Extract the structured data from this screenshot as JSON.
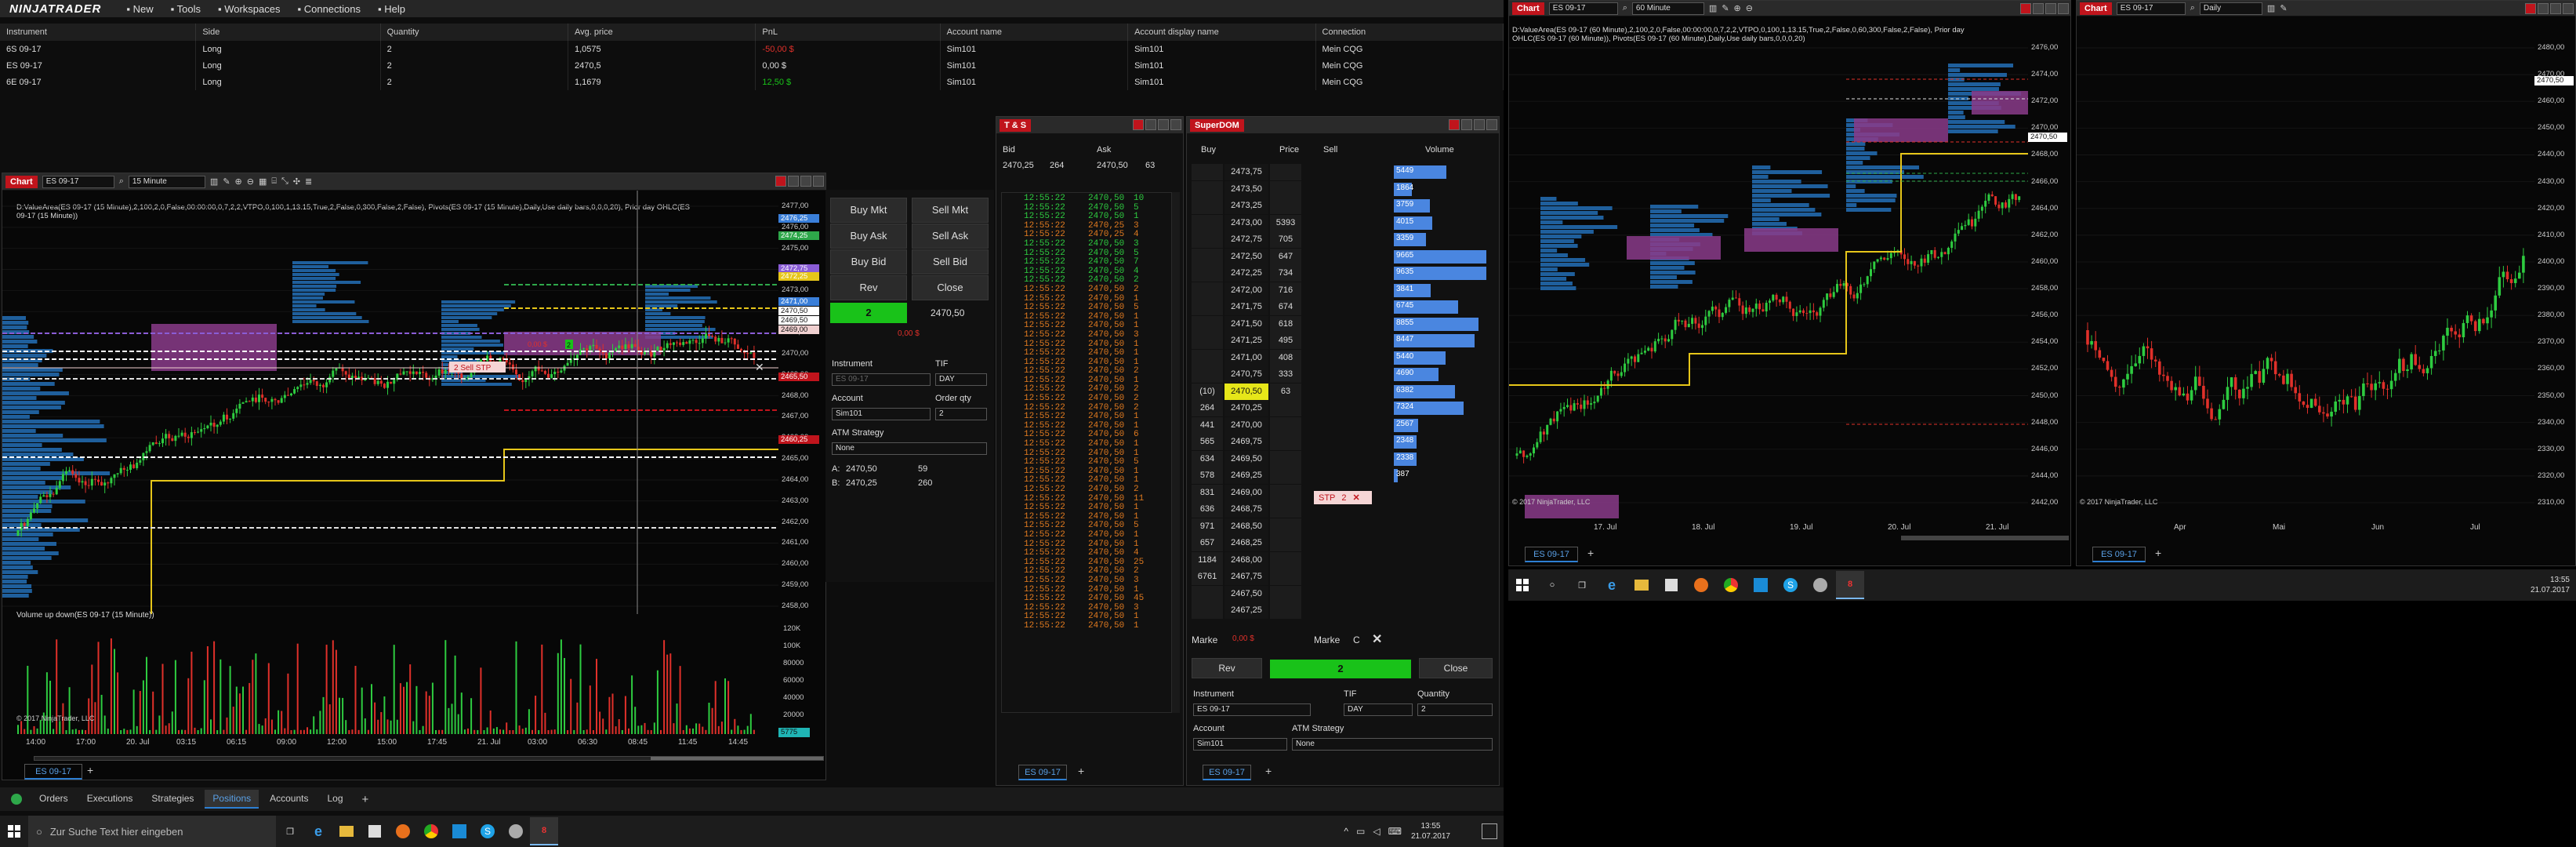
{
  "app": {
    "name": "NINJATRADER",
    "menu": [
      "New",
      "Tools",
      "Workspaces",
      "Connections",
      "Help"
    ]
  },
  "positions": {
    "columns": [
      "Instrument",
      "Side",
      "Quantity",
      "Avg. price",
      "PnL",
      "Account name",
      "Account display name",
      "Connection"
    ],
    "rows": [
      [
        "6S 09-17",
        "Long",
        "2",
        "1,0575",
        "-50,00 $",
        "Sim101",
        "Sim101",
        "Mein CQG"
      ],
      [
        "ES 09-17",
        "Long",
        "2",
        "2470,5",
        "0,00 $",
        "Sim101",
        "Sim101",
        "Mein CQG"
      ],
      [
        "6E 09-17",
        "Long",
        "2",
        "1,1679",
        "12,50 $",
        "Sim101",
        "Sim101",
        "Mein CQG"
      ]
    ],
    "pnl_colors": [
      "#e0302a",
      "#dddddd",
      "#19c219"
    ]
  },
  "chart1": {
    "tag": "Chart",
    "instrument": "ES 09-17",
    "interval": "15 Minute",
    "info1": "D:ValueArea(ES 09-17 (15 Minute),2,100,2,0,False,00:00:00,0,7,2,2,VTPO,0,100,1,13.15,True,2,False,0,300,False,2,False), Pivots(ES 09-17 (15 Minute),Daily,Use daily bars,0,0,0,20), Prior day OHLC(ES",
    "info2": "09-17 (15 Minute))",
    "price_ticks": [
      "2477,00",
      "2476,00",
      "2475,00",
      "2474,00",
      "2473,00",
      "2472,00",
      "2471,00",
      "2470,00",
      "2469,00",
      "2468,00",
      "2467,00",
      "2466,00",
      "2465,00",
      "2464,00",
      "2463,00",
      "2462,00",
      "2461,00",
      "2460,00",
      "2459,00",
      "2458,00"
    ],
    "price_tags": [
      {
        "label": "2476,25",
        "color": "#3a7fd9"
      },
      {
        "label": "2474,25",
        "color": "#2ea84a"
      },
      {
        "label": "2472,75",
        "color": "#8a5cd6"
      },
      {
        "label": "2472,25",
        "color": "#e6c619"
      },
      {
        "label": "2471,00",
        "color": "#3a7fd9"
      },
      {
        "label": "2470,50",
        "color": "#ffffff"
      },
      {
        "label": "2469,50",
        "color": "#ffffff"
      },
      {
        "label": "2469,00",
        "color": "#f0d0d0"
      },
      {
        "label": "2465,50",
        "color": "#c0141c"
      },
      {
        "label": "2460,25",
        "color": "#c0141c"
      }
    ],
    "order_label": "2  Sell STP",
    "pnl_marker": "0,00 $",
    "qty_marker": "2",
    "volume_title": "Volume up down(ES 09-17 (15 Minute))",
    "vol_ticks": [
      "120K",
      "100K",
      "80000",
      "60000",
      "40000",
      "20000"
    ],
    "vol_tag": "5775",
    "time_ticks": [
      "14:00",
      "17:00",
      "20. Jul",
      "03:15",
      "06:15",
      "09:00",
      "12:00",
      "15:00",
      "17:45",
      "21. Jul",
      "03:00",
      "06:30",
      "08:45",
      "11:45",
      "14:45"
    ],
    "copyright": "© 2017 NinjaTrader, LLC",
    "tab": "ES 09-17"
  },
  "chart_trader": {
    "buy_mkt": "Buy Mkt",
    "sell_mkt": "Sell Mkt",
    "buy_ask": "Buy Ask",
    "sell_ask": "Sell Ask",
    "buy_bid": "Buy Bid",
    "sell_bid": "Sell Bid",
    "rev": "Rev",
    "close": "Close",
    "qty": "2",
    "price": "2470,50",
    "pnl": "0,00 $",
    "instrument_label": "Instrument",
    "instrument": "ES 09-17",
    "tif_label": "TIF",
    "tif": "DAY",
    "account_label": "Account",
    "account": "Sim101",
    "orderqty_label": "Order qty",
    "orderqty": "2",
    "atm_label": "ATM Strategy",
    "atm": "None",
    "a_label": "A:",
    "a_price": "2470,50",
    "a_size": "59",
    "b_label": "B:",
    "b_price": "2470,25",
    "b_size": "260"
  },
  "ts": {
    "tag": "T & S",
    "bid_label": "Bid",
    "ask_label": "Ask",
    "bid": "2470,25",
    "bid_size": "264",
    "ask": "2470,50",
    "ask_size": "63",
    "rows": [
      [
        "12:55:22",
        "2470,50",
        "10",
        "g"
      ],
      [
        "12:55:22",
        "2470,50",
        "5",
        "g"
      ],
      [
        "12:55:22",
        "2470,50",
        "1",
        "g"
      ],
      [
        "12:55:22",
        "2470,25",
        "3",
        "o"
      ],
      [
        "12:55:22",
        "2470,25",
        "4",
        "o"
      ],
      [
        "12:55:22",
        "2470,50",
        "3",
        "g"
      ],
      [
        "12:55:22",
        "2470,50",
        "5",
        "g"
      ],
      [
        "12:55:22",
        "2470,50",
        "7",
        "g"
      ],
      [
        "12:55:22",
        "2470,50",
        "4",
        "g"
      ],
      [
        "12:55:22",
        "2470,50",
        "2",
        "g"
      ],
      [
        "12:55:22",
        "2470,50",
        "2",
        "o"
      ],
      [
        "12:55:22",
        "2470,50",
        "1",
        "o"
      ],
      [
        "12:55:22",
        "2470,50",
        "5",
        "o"
      ],
      [
        "12:55:22",
        "2470,50",
        "1",
        "o"
      ],
      [
        "12:55:22",
        "2470,50",
        "1",
        "o"
      ],
      [
        "12:55:22",
        "2470,50",
        "3",
        "o"
      ],
      [
        "12:55:22",
        "2470,50",
        "1",
        "o"
      ],
      [
        "12:55:22",
        "2470,50",
        "1",
        "o"
      ],
      [
        "12:55:22",
        "2470,50",
        "1",
        "o"
      ],
      [
        "12:55:22",
        "2470,50",
        "2",
        "o"
      ],
      [
        "12:55:22",
        "2470,50",
        "1",
        "o"
      ],
      [
        "12:55:22",
        "2470,50",
        "2",
        "o"
      ],
      [
        "12:55:22",
        "2470,50",
        "2",
        "o"
      ],
      [
        "12:55:22",
        "2470,50",
        "2",
        "o"
      ],
      [
        "12:55:22",
        "2470,50",
        "1",
        "o"
      ],
      [
        "12:55:22",
        "2470,50",
        "1",
        "o"
      ],
      [
        "12:55:22",
        "2470,50",
        "6",
        "o"
      ],
      [
        "12:55:22",
        "2470,50",
        "1",
        "o"
      ],
      [
        "12:55:22",
        "2470,50",
        "1",
        "o"
      ],
      [
        "12:55:22",
        "2470,50",
        "5",
        "o"
      ],
      [
        "12:55:22",
        "2470,50",
        "1",
        "o"
      ],
      [
        "12:55:22",
        "2470,50",
        "1",
        "o"
      ],
      [
        "12:55:22",
        "2470,50",
        "2",
        "o"
      ],
      [
        "12:55:22",
        "2470,50",
        "11",
        "o"
      ],
      [
        "12:55:22",
        "2470,50",
        "1",
        "o"
      ],
      [
        "12:55:22",
        "2470,50",
        "1",
        "o"
      ],
      [
        "12:55:22",
        "2470,50",
        "5",
        "o"
      ],
      [
        "12:55:22",
        "2470,50",
        "1",
        "o"
      ],
      [
        "12:55:22",
        "2470,50",
        "1",
        "o"
      ],
      [
        "12:55:22",
        "2470,50",
        "4",
        "o"
      ],
      [
        "12:55:22",
        "2470,50",
        "25",
        "o"
      ],
      [
        "12:55:22",
        "2470,50",
        "2",
        "o"
      ],
      [
        "12:55:22",
        "2470,50",
        "3",
        "o"
      ],
      [
        "12:55:22",
        "2470,50",
        "1",
        "o"
      ],
      [
        "12:55:22",
        "2470,50",
        "45",
        "o"
      ],
      [
        "12:55:22",
        "2470,50",
        "3",
        "o"
      ],
      [
        "12:55:22",
        "2470,50",
        "1",
        "o"
      ],
      [
        "12:55:22",
        "2470,50",
        "1",
        "o"
      ]
    ],
    "tab": "ES 09-17"
  },
  "dom": {
    "tag": "SuperDOM",
    "buy_label": "Buy",
    "price_label": "Price",
    "sell_label": "Sell",
    "volume_label": "Volume",
    "rows": [
      [
        "",
        "2473,75",
        "",
        "5449"
      ],
      [
        "",
        "2473,50",
        "",
        "1864"
      ],
      [
        "",
        "2473,25",
        "",
        "3759"
      ],
      [
        "",
        "2473,00",
        "5393",
        "4015"
      ],
      [
        "",
        "2472,75",
        "705",
        "3359"
      ],
      [
        "",
        "2472,50",
        "647",
        "9665"
      ],
      [
        "",
        "2472,25",
        "734",
        "9635"
      ],
      [
        "",
        "2472,00",
        "716",
        "3841"
      ],
      [
        "",
        "2471,75",
        "674",
        "6745"
      ],
      [
        "",
        "2471,50",
        "618",
        "8855"
      ],
      [
        "",
        "2471,25",
        "495",
        "8447"
      ],
      [
        "",
        "2471,00",
        "408",
        "5440"
      ],
      [
        "",
        "2470,75",
        "333",
        "4690"
      ],
      [
        "(10)",
        "2470,50",
        "63",
        "6382"
      ],
      [
        "264",
        "2470,25",
        "",
        "7324"
      ],
      [
        "441",
        "2470,00",
        "",
        "2567"
      ],
      [
        "565",
        "2469,75",
        "",
        "2348"
      ],
      [
        "634",
        "2469,50",
        "",
        "2338"
      ],
      [
        "578",
        "2469,25",
        "",
        "387"
      ],
      [
        "831",
        "2469,00",
        "",
        ""
      ],
      [
        "636",
        "2468,75",
        "",
        ""
      ],
      [
        "971",
        "2468,50",
        "",
        ""
      ],
      [
        "657",
        "2468,25",
        "",
        ""
      ],
      [
        "1184",
        "2468,00",
        "",
        ""
      ],
      [
        "6761",
        "2467,75",
        "",
        ""
      ],
      [
        "",
        "2467,50",
        "",
        ""
      ],
      [
        "",
        "2467,25",
        "",
        ""
      ]
    ],
    "stp_label": "STP",
    "stp_qty": "2",
    "marke": "Marke",
    "pnl": "0,00 $",
    "marke2": "Marke",
    "c_label": "C",
    "rev": "Rev",
    "qty": "2",
    "close": "Close",
    "instrument_label": "Instrument",
    "instrument": "ES 09-17",
    "tif_label": "TIF",
    "tif": "DAY",
    "qty_label": "Quantity",
    "quantity": "2",
    "account_label": "Account",
    "account": "Sim101",
    "atm_label": "ATM Strategy",
    "atm": "None",
    "tab": "ES 09-17"
  },
  "chart2": {
    "tag": "Chart",
    "instrument": "ES 09-17",
    "interval": "60 Minute",
    "info1": "D:ValueArea(ES 09-17 (60 Minute),2,100,2,0,False,00:00:00,0,7,2,2,VTPO,0,100,1,13.15,True,2,False,0,60,300,False,2,False), Prior day",
    "info2": "OHLC(ES 09-17 (60 Minute)), Pivots(ES 09-17 (60 Minute),Daily,Use daily bars,0,0,0,20)",
    "price_ticks": [
      "2476,00",
      "2474,00",
      "2472,00",
      "2470,00",
      "2468,00",
      "2466,00",
      "2464,00",
      "2462,00",
      "2460,00",
      "2458,00",
      "2456,00",
      "2454,00",
      "2452,00",
      "2450,00",
      "2448,00",
      "2446,00",
      "2444,00",
      "2442,00"
    ],
    "price_tag": "2470,50",
    "time_ticks": [
      "17. Jul",
      "18. Jul",
      "19. Jul",
      "20. Jul",
      "21. Jul"
    ],
    "copyright": "© 2017 NinjaTrader, LLC",
    "tab": "ES 09-17"
  },
  "chart3": {
    "tag": "Chart",
    "instrument": "ES 09-17",
    "interval": "Daily",
    "price_ticks": [
      "2480,00",
      "2470,00",
      "2460,00",
      "2450,00",
      "2440,00",
      "2430,00",
      "2420,00",
      "2410,00",
      "2400,00",
      "2390,00",
      "2380,00",
      "2370,00",
      "2360,00",
      "2350,00",
      "2340,00",
      "2330,00",
      "2320,00",
      "2310,00"
    ],
    "price_tag": "2470,50",
    "time_ticks": [
      "Apr",
      "Mai",
      "Jun",
      "Jul"
    ],
    "copyright": "© 2017 NinjaTrader, LLC",
    "tab": "ES 09-17"
  },
  "bottom_tabs": [
    "Orders",
    "Executions",
    "Strategies",
    "Positions",
    "Accounts",
    "Log"
  ],
  "bottom_active": "Positions",
  "taskbar": {
    "search": "Zur Suche Text hier eingeben",
    "time": "13:55",
    "date": "21.07.2017"
  },
  "taskbar2": {
    "time": "13:55",
    "date": "21.07.2017"
  }
}
